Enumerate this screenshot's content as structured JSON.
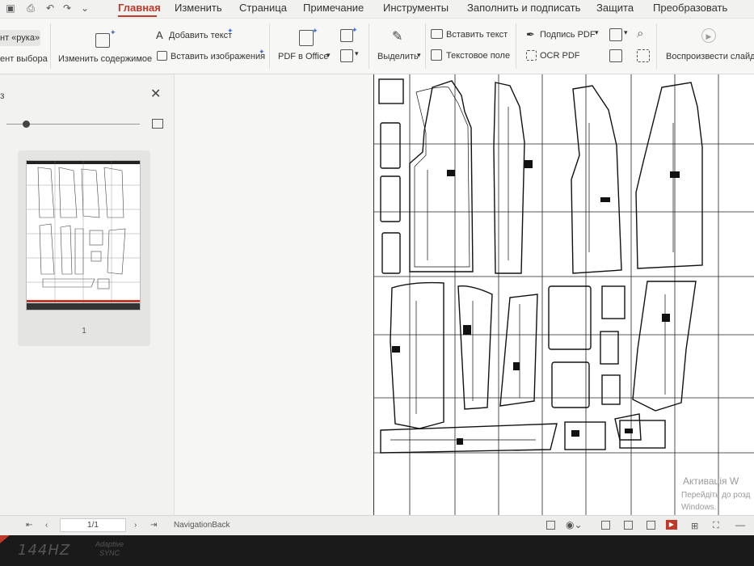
{
  "tabs": {
    "home": "Главная",
    "edit": "Изменить",
    "page": "Страница",
    "comment": "Примечание",
    "tools": "Инструменты",
    "fill_sign": "Заполнить и подписать",
    "protect": "Защита",
    "convert": "Преобразовать"
  },
  "ribbon": {
    "hand_tool": "нт «рука»",
    "select_tool": "ент выбора",
    "edit_content": "Изменить содержимое",
    "add_text": "Добавить текст",
    "insert_image": "Вставить изображения",
    "pdf_to_office": "PDF в Office",
    "highlight": "Выделить",
    "insert_text": "Вставить текст",
    "text_field": "Текстовое поле",
    "sign_pdf": "Подпись PDF",
    "ocr_pdf": "OCR PDF",
    "play_slideshow": "Воспроизвести слайд"
  },
  "left_panel": {
    "title": "з",
    "page_number": "1"
  },
  "status_bar": {
    "page_indicator": "1/1",
    "navigation": "NavigationBack"
  },
  "watermark": {
    "line1": "Активація W",
    "line2": "Перейдіть до розд",
    "line3": "Windows."
  },
  "bezel": {
    "refresh": "144HZ",
    "adaptive_line1": "Adaptive",
    "adaptive_line2": "SYNC"
  },
  "colors": {
    "accent": "#c0392b",
    "spark": "#3b6fd8"
  }
}
